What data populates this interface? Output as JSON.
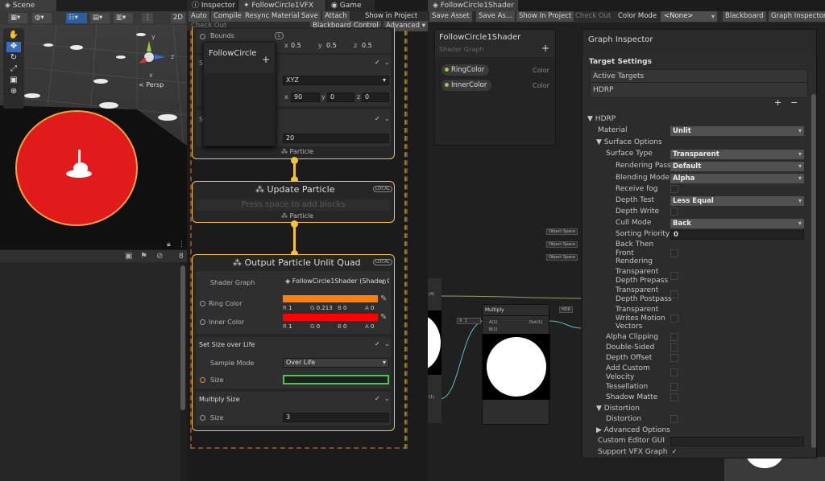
{
  "scene": {
    "tab": "Scene",
    "persp": "< Persp",
    "btn_2d": "2D",
    "axis_y": "y",
    "axis_x": "x",
    "axis_z": "z",
    "hierarchy_count": "8"
  },
  "tabs": {
    "inspector": "Inspector",
    "vfx": "FollowCircle1VFX",
    "game": "Game",
    "shader": "FollowCircle1Shader"
  },
  "vfx_toolbar": {
    "auto": "Auto",
    "compile": "Compile",
    "resync": "Resync Material",
    "save": "Save",
    "attach": "Attach",
    "show_in_project": "Show in Project",
    "check_out": "Check Out",
    "blackboard": "Blackboard",
    "control": "Control",
    "advanced": "Advanced"
  },
  "init_block": {
    "bounds_label": "Bounds",
    "bounds_tag": "L",
    "vals": [
      "0.5",
      "0.5",
      "0.5"
    ],
    "letters": [
      "x",
      "y",
      "z"
    ],
    "sec1": "Se",
    "sec2": "Se",
    "mode": "XYZ",
    "rot": [
      "90",
      "0",
      "0"
    ],
    "num": "20",
    "context_footer": "Particle"
  },
  "bb_popup": {
    "title": "FollowCircle",
    "add": "+"
  },
  "update_block": {
    "title": "Update Particle",
    "local": "LOCAL",
    "hint": "Press space to add blocks",
    "footer": "Particle"
  },
  "output_block": {
    "title": "Output Particle Unlit Quad",
    "local": "LOCAL",
    "shader_graph_label": "Shader Graph",
    "shader_graph_value": "FollowCircle1Shader (Shader Grap",
    "ring_label": "Ring Color",
    "ring_rgba": {
      "R": "1",
      "G": "0.213",
      "B": "0",
      "A": "0"
    },
    "inner_label": "Inner Color",
    "inner_rgba": {
      "R": "1",
      "G": "0",
      "B": "0",
      "A": "0"
    },
    "size_life_title": "Set Size over Life",
    "sample_mode_label": "Sample Mode",
    "sample_mode_value": "Over Life",
    "size_label": "Size",
    "mult_title": "Multiply Size",
    "mult_size_label": "Size",
    "mult_size_value": "3"
  },
  "shader_toolbar": {
    "save_asset": "Save Asset",
    "save_as": "Save As...",
    "show_in_project": "Show In Project",
    "check_out": "Check Out",
    "color_mode": "Color Mode",
    "color_mode_value": "<None>",
    "blackboard": "Blackboard",
    "graph_inspector": "Graph Inspector"
  },
  "shader_blackboard": {
    "title": "FollowCircle1Shader",
    "subtitle": "Shader Graph",
    "add": "+",
    "props": [
      {
        "name": "RingColor",
        "type": "Color"
      },
      {
        "name": "InnerColor",
        "type": "Color"
      }
    ]
  },
  "graph_nodes": {
    "object_space": [
      "Object Space",
      "Object Space",
      "Object Space"
    ],
    "multiply_title": "Multiply",
    "multiply_in_a": "A(1)",
    "multiply_in_b": "B(1)",
    "multiply_out": "Out(1)",
    "x_label": "X",
    "x_val": "1",
    "hdr": "HDR",
    "left_port": "(4)",
    "left_port2": "(1)"
  },
  "graph_inspector": {
    "title": "Graph Inspector",
    "target_settings": "Target Settings",
    "active_targets": "Active Targets",
    "hdrp_item": "HDRP",
    "add": "+",
    "remove": "−",
    "hdrp_header": "HDRP",
    "material_label": "Material",
    "material_value": "Unlit",
    "surface_options": "Surface Options",
    "surface_type_label": "Surface Type",
    "surface_type_value": "Transparent",
    "rendering_pass_label": "Rendering Pass",
    "rendering_pass_value": "Default",
    "blending_mode_label": "Blending Mode",
    "blending_mode_value": "Alpha",
    "receive_fog": "Receive fog",
    "depth_test_label": "Depth Test",
    "depth_test_value": "Less Equal",
    "depth_write": "Depth Write",
    "cull_mode_label": "Cull Mode",
    "cull_mode_value": "Back",
    "sorting_priority_label": "Sorting Priority",
    "sorting_priority_value": "0",
    "back_then_front_1": "Back Then",
    "back_then_front_2": "Front",
    "back_then_front_3": "Rendering",
    "tdp_1": "Transparent",
    "tdp_2": "Depth Prepass",
    "tdpo_1": "Transparent",
    "tdpo_2": "Depth Postpass",
    "twmv_1": "Transparent",
    "twmv_2": "Writes Motion",
    "twmv_3": "Vectors",
    "alpha_clipping": "Alpha Clipping",
    "double_sided": "Double-Sided",
    "depth_offset": "Depth Offset",
    "add_custom_1": "Add Custom",
    "add_custom_2": "Velocity",
    "tessellation": "Tessellation",
    "shadow_matte": "Shadow Matte",
    "distortion_header": "Distortion",
    "distortion": "Distortion",
    "advanced_options": "Advanced Options",
    "custom_editor_gui": "Custom Editor GUI",
    "support_vfx_graph": "Support VFX Graph"
  }
}
